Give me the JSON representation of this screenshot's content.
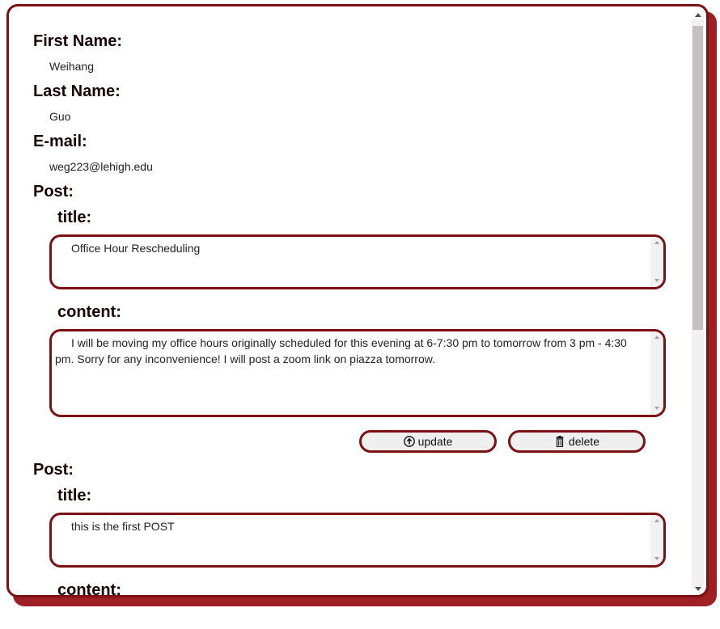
{
  "profile": {
    "first_name_label": "First Name:",
    "first_name": "Weihang",
    "last_name_label": "Last Name:",
    "last_name": "Guo",
    "email_label": "E-mail:",
    "email": "weg223@lehigh.edu"
  },
  "posts": [
    {
      "label": "Post:",
      "title_label": "title:",
      "title": "Office Hour Rescheduling",
      "content_label": "content:",
      "content": "I will be moving my office hours originally scheduled for this evening at 6-7:30 pm to tomorrow from 3 pm - 4:30 pm. Sorry for any inconvenience! I will post a zoom link on piazza tomorrow.",
      "update_label": "update",
      "delete_label": "delete"
    },
    {
      "label": "Post:",
      "title_label": "title:",
      "title": "this is the first POST",
      "content_label": "content:"
    }
  ],
  "icons": {
    "update": "arrow-up-circle-icon",
    "delete": "trash-icon"
  },
  "colors": {
    "border": "#7c1012",
    "shadow": "#9e1f24"
  }
}
